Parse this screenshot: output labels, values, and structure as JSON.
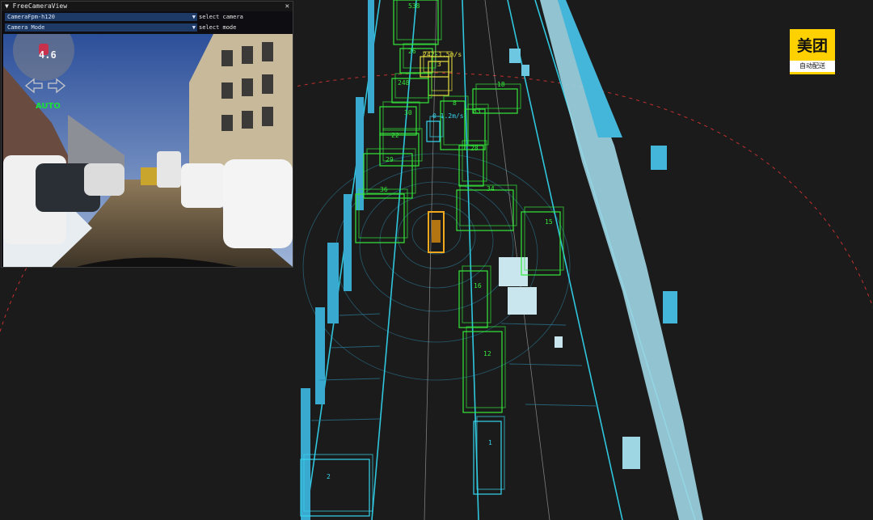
{
  "window": {
    "title": "▼ FreeCameraView",
    "close_icon": "close-icon"
  },
  "camera_select": {
    "value": "CameraFpm-h120",
    "label": "select camera"
  },
  "mode_select": {
    "value": "Camera Mode",
    "label": "select mode"
  },
  "overlay": {
    "value": "4.6",
    "mode": "AUTO",
    "left_arrow": "arrow-left-icon",
    "right_arrow": "arrow-right-icon"
  },
  "logo": {
    "main": "美团",
    "sub": "自动配送"
  },
  "colors": {
    "track_green": "#34e83a",
    "track_cyan": "#35d6ee",
    "ego": "#f2a81d",
    "lane": "#2fc6de",
    "points": "#3fb7dc"
  },
  "tracks": [
    {
      "id": "26",
      "color": "green"
    },
    {
      "id": "242-1.5m/s",
      "color": "yellow"
    },
    {
      "id": "3",
      "color": "yellow"
    },
    {
      "id": "18",
      "color": "green"
    },
    {
      "id": "8",
      "color": "green"
    },
    {
      "id": "83",
      "color": "green"
    },
    {
      "id": "0-1.2m/s",
      "color": "cyan"
    },
    {
      "id": "28",
      "color": "green"
    },
    {
      "id": "34",
      "color": "green"
    },
    {
      "id": "15",
      "color": "green"
    },
    {
      "id": "16",
      "color": "green"
    },
    {
      "id": "12",
      "color": "green"
    },
    {
      "id": "1",
      "color": "cyan"
    },
    {
      "id": "2",
      "color": "cyan"
    },
    {
      "id": "22",
      "color": "green"
    },
    {
      "id": "30",
      "color": "green"
    },
    {
      "id": "248",
      "color": "green"
    },
    {
      "id": "29",
      "color": "green"
    },
    {
      "id": "36",
      "color": "green"
    },
    {
      "id": "538",
      "color": "green"
    }
  ]
}
